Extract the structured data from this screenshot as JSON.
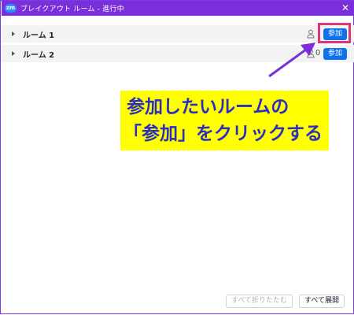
{
  "window": {
    "logo": "zm",
    "title": "ブレイクアウト ルーム - 進行中",
    "close": "✕"
  },
  "rooms": [
    {
      "name": "ルーム 1",
      "count": "",
      "join_label": "参加"
    },
    {
      "name": "ルーム 2",
      "count": "0",
      "join_label": "参加"
    }
  ],
  "annotation": {
    "line1": "参加したいルームの",
    "line2": "「参加」をクリックする",
    "colors": {
      "background": "#ffff00",
      "text": "#2a2fbf",
      "arrow": "#7b2fd9",
      "highlight": "#e0357a"
    }
  },
  "footer": {
    "collapse_all": "すべて折りたたむ",
    "expand_all": "すべて展開"
  },
  "colors": {
    "titlebar": "#7a2fd9",
    "accent": "#0e72ed"
  }
}
